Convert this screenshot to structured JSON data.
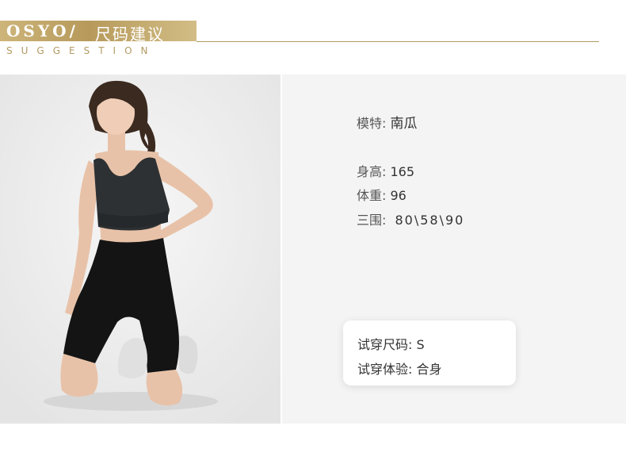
{
  "header": {
    "brand": "OSYO/",
    "title_cn": "尺码建议",
    "subtitle": "SUGGESTION"
  },
  "model": {
    "name_label": "模特:",
    "name_value": "南瓜",
    "height_label": "身高:",
    "height_value": "165",
    "weight_label": "体重:",
    "weight_value": "96",
    "measurements_label": "三围:",
    "measurements_value": "80\\58\\90"
  },
  "fit_card": {
    "size_label": "试穿尺码:",
    "size_value": "S",
    "experience_label": "试穿体验:",
    "experience_value": "合身"
  },
  "colors": {
    "accent_gold": "#b79a5b",
    "top_color": "#2e3133",
    "shorts_color": "#141414"
  }
}
